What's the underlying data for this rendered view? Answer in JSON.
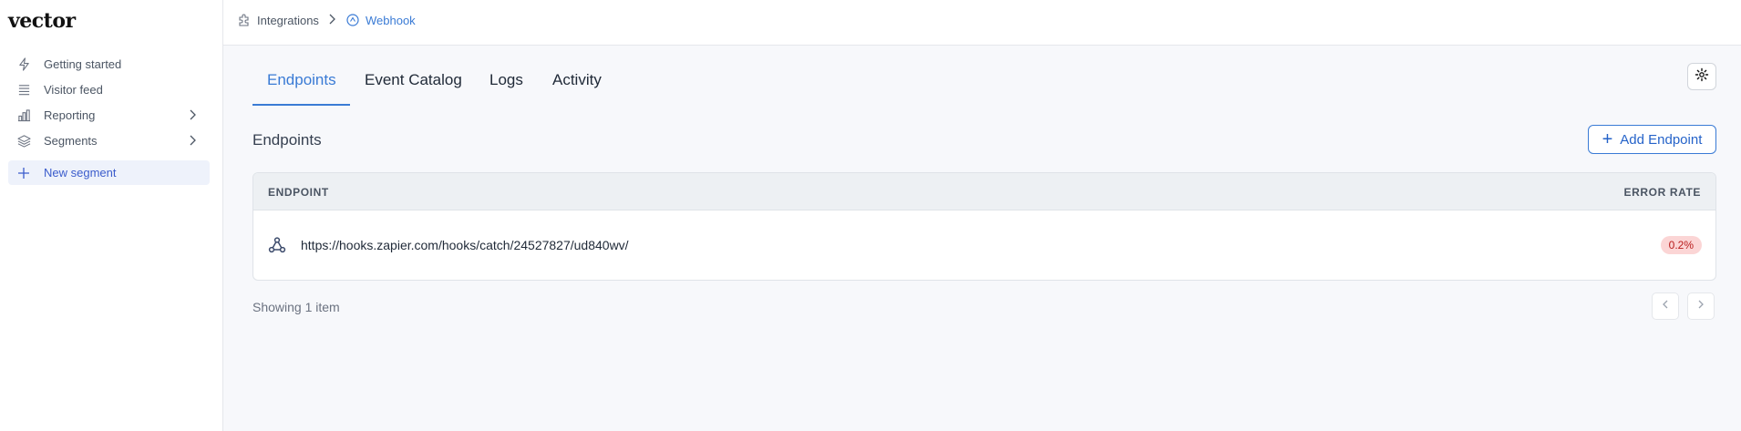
{
  "sidebar": {
    "logo": "vector",
    "items": [
      {
        "label": "Getting started",
        "icon": "lightning-icon"
      },
      {
        "label": "Visitor feed",
        "icon": "list-icon"
      },
      {
        "label": "Reporting",
        "icon": "bar-chart-icon"
      },
      {
        "label": "Segments",
        "icon": "layers-icon"
      },
      {
        "label": "New segment",
        "icon": "plus-icon"
      }
    ]
  },
  "header": {
    "breadcrumb": [
      {
        "label": "Integrations",
        "icon": "puzzle-icon"
      },
      {
        "label": "Webhook",
        "icon": "webhook-icon"
      }
    ]
  },
  "tabs": [
    {
      "label": "Endpoints",
      "active": true
    },
    {
      "label": "Event Catalog",
      "active": false
    },
    {
      "label": "Logs",
      "active": false
    },
    {
      "label": "Activity",
      "active": false
    }
  ],
  "section": {
    "title": "Endpoints",
    "add_button": "Add Endpoint"
  },
  "table": {
    "columns": [
      "ENDPOINT",
      "ERROR RATE"
    ],
    "rows": [
      {
        "url": "https://hooks.zapier.com/hooks/catch/24527827/ud840wv/",
        "error_rate": "0.2%"
      }
    ]
  },
  "footer": {
    "showing": "Showing 1 item"
  },
  "colors": {
    "accent": "#3a7bd5",
    "error_badge_bg": "#fbd5d5",
    "error_badge_text": "#b91c1c"
  }
}
